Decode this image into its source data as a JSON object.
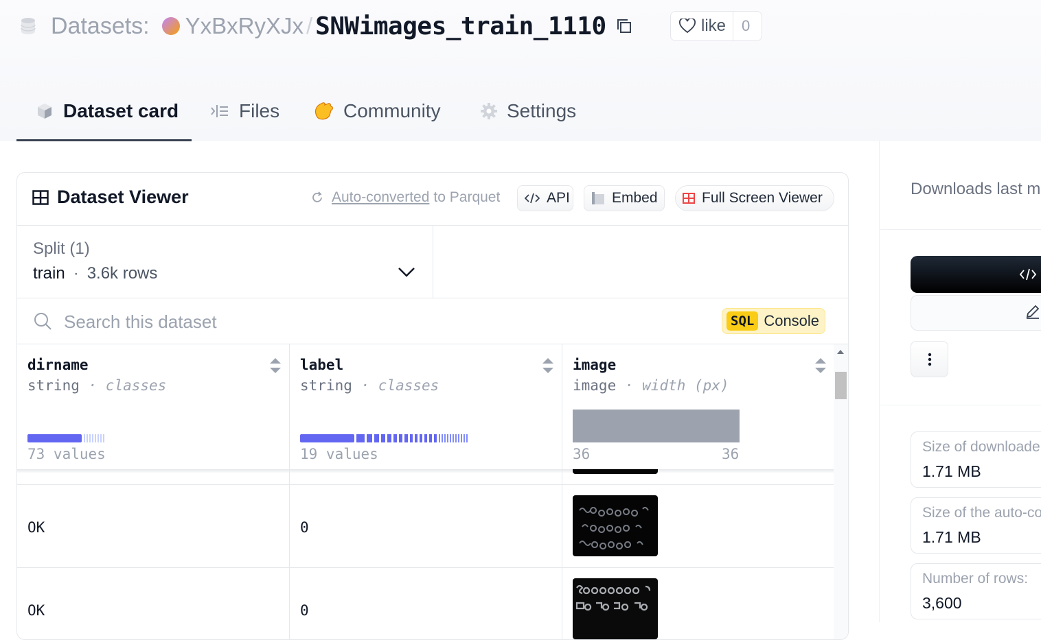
{
  "breadcrumb": {
    "section": "Datasets:",
    "org": "YxBxRyXJx",
    "separator": "/",
    "dataset": "SNWimages_train_1110"
  },
  "like": {
    "label": "like",
    "count": "0"
  },
  "tabs": [
    {
      "label": "Dataset card",
      "icon": "cube-icon",
      "active": true
    },
    {
      "label": "Files",
      "icon": "files-icon",
      "active": false
    },
    {
      "label": "Community",
      "icon": "clapping-hands-icon",
      "active": false
    },
    {
      "label": "Settings",
      "icon": "gear-icon",
      "active": false
    }
  ],
  "viewer": {
    "title": "Dataset Viewer",
    "auto_converted_link": "Auto-converted",
    "auto_converted_rest": "to Parquet",
    "api_label": "API",
    "embed_label": "Embed",
    "fullscreen_label": "Full Screen Viewer",
    "split_label": "Split (1)",
    "split_name": "train",
    "split_dot": "·",
    "split_rows": "3.6k rows",
    "search_placeholder": "Search this dataset",
    "sql_tag": "SQL",
    "sql_label": "Console"
  },
  "columns": [
    {
      "name": "dirname",
      "type": "string",
      "sub": "· classes",
      "stat": "73 values",
      "class_fraction": 0.2
    },
    {
      "name": "label",
      "type": "string",
      "sub": "· classes",
      "stat": "19 values",
      "class_fraction": 0.2
    },
    {
      "name": "image",
      "type": "image",
      "sub": "· width (px)",
      "min": "36",
      "max": "36"
    }
  ],
  "rows": [
    {
      "dirname": "OK",
      "label": "0"
    },
    {
      "dirname": "OK",
      "label": "0"
    }
  ],
  "sidebar": {
    "downloads_label": "Downloads last m",
    "stats": [
      {
        "label": "Size of downloade",
        "value": "1.71 MB"
      },
      {
        "label": "Size of the auto-co",
        "value": "1.71 MB"
      },
      {
        "label": "Number of rows:",
        "value": "3,600"
      }
    ]
  },
  "colors": {
    "histogram": "#6366f1",
    "sql_bg": "#fef3c7",
    "sql_tag": "#facc15"
  }
}
